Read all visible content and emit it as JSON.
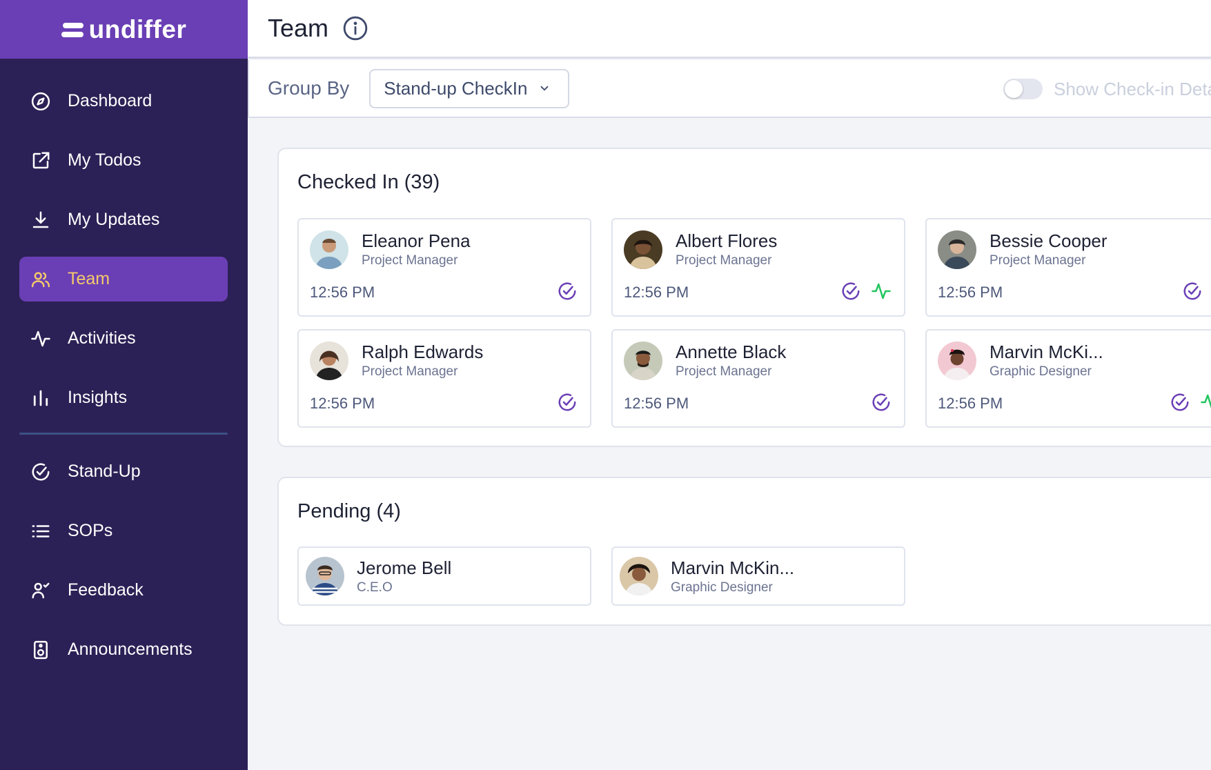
{
  "brand": {
    "name": "undiffer"
  },
  "sidebar": {
    "items": [
      {
        "label": "Dashboard",
        "icon": "compass-icon"
      },
      {
        "label": "My Todos",
        "icon": "external-link-icon"
      },
      {
        "label": "My Updates",
        "icon": "download-icon"
      },
      {
        "label": "Team",
        "icon": "users-icon",
        "active": true
      },
      {
        "label": "Activities",
        "icon": "activity-icon"
      },
      {
        "label": "Insights",
        "icon": "bar-chart-icon"
      },
      {
        "label": "Stand-Up",
        "icon": "check-circle-icon"
      },
      {
        "label": "SOPs",
        "icon": "list-icon"
      },
      {
        "label": "Feedback",
        "icon": "user-feedback-icon"
      },
      {
        "label": "Announcements",
        "icon": "speaker-icon"
      }
    ]
  },
  "header": {
    "title": "Team",
    "icon": "info-icon"
  },
  "toolbar": {
    "group_by_label": "Group By",
    "group_by_value": "Stand-up CheckIn",
    "toggle_label": "Show Check-in Details",
    "toggle_on": false
  },
  "checked_in": {
    "title": "Checked In (39)",
    "members": [
      {
        "name": "Eleanor Pena",
        "role": "Project Manager",
        "time": "12:56 PM",
        "checked": true,
        "activity": false
      },
      {
        "name": "Albert Flores",
        "role": "Project Manager",
        "time": "12:56 PM",
        "checked": true,
        "activity": true
      },
      {
        "name": "Bessie Cooper",
        "role": "Project Manager",
        "time": "12:56 PM",
        "checked": true,
        "activity": false
      },
      {
        "name": "Ralph Edwards",
        "role": "Project Manager",
        "time": "12:56 PM",
        "checked": true,
        "activity": false
      },
      {
        "name": "Annette Black",
        "role": "Project Manager",
        "time": "12:56 PM",
        "checked": true,
        "activity": false
      },
      {
        "name": "Marvin McKi...",
        "role": "Graphic Designer",
        "time": "12:56 PM",
        "checked": true,
        "activity": true
      }
    ]
  },
  "pending": {
    "title": "Pending (4)",
    "members": [
      {
        "name": "Jerome Bell",
        "role": "C.E.O"
      },
      {
        "name": "Marvin McKin...",
        "role": "Graphic Designer"
      }
    ]
  },
  "colors": {
    "sidebar_bg": "#2c2156",
    "brand_bg": "#6a3fb5",
    "active_item_bg": "#6a3fb5",
    "active_item_text": "#f5c96a",
    "check_icon": "#6a3fb5",
    "activity_icon": "#22c55e"
  }
}
